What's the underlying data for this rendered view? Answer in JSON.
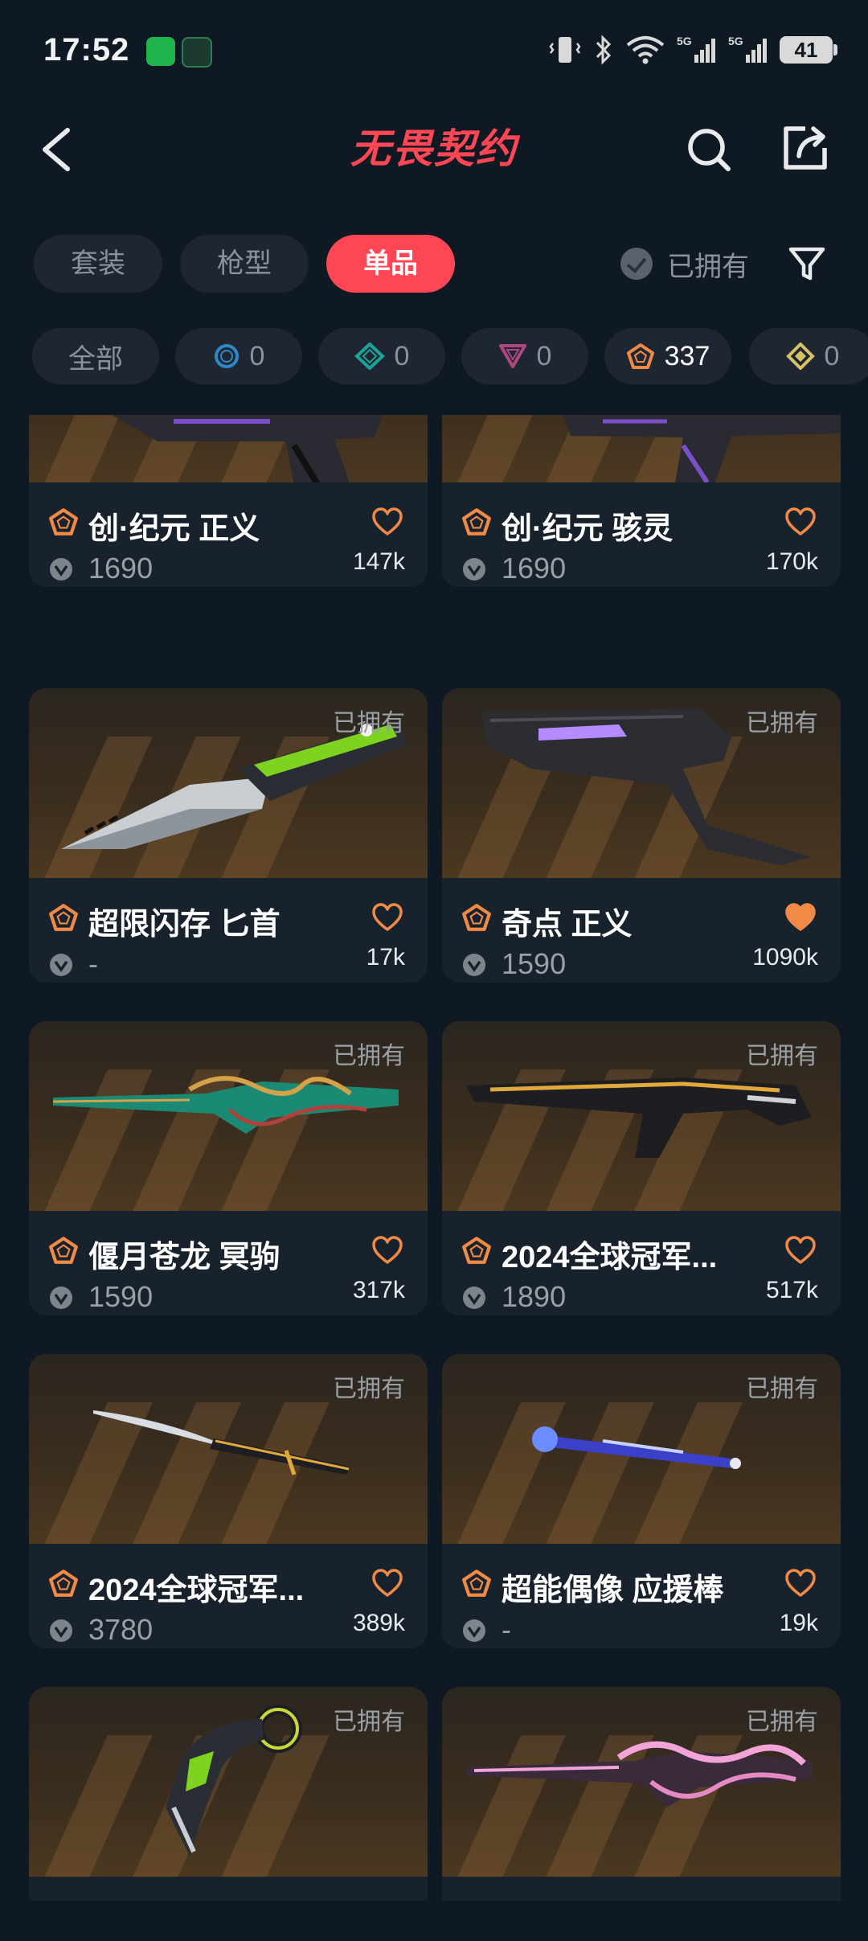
{
  "status_bar": {
    "time": "17:52",
    "battery": "41"
  },
  "header": {
    "logo_text": "无畏契约"
  },
  "tabs": [
    {
      "label": "套装",
      "active": false
    },
    {
      "label": "枪型",
      "active": false
    },
    {
      "label": "单品",
      "active": true
    }
  ],
  "owned_filter": {
    "label": "已拥有"
  },
  "rarity_chips": [
    {
      "label": "全部",
      "count": "",
      "icon": "none",
      "color": ""
    },
    {
      "label": "",
      "count": "0",
      "icon": "select-tier-icon",
      "color": "#2e88c8"
    },
    {
      "label": "",
      "count": "0",
      "icon": "deluxe-tier-icon",
      "color": "#1aa39a"
    },
    {
      "label": "",
      "count": "0",
      "icon": "premium-tier-icon",
      "color": "#b0457f"
    },
    {
      "label": "",
      "count": "337",
      "icon": "exclusive-tier-icon",
      "color": "#f08a46"
    },
    {
      "label": "",
      "count": "0",
      "icon": "ultra-tier-icon",
      "color": "#d8c266"
    }
  ],
  "accent_color": "#ff4655",
  "items": [
    {
      "name": "创·纪元 正义",
      "price": "1690",
      "likes": "147k",
      "owned_label": "",
      "favorited": false,
      "weapon": "pistol-dark"
    },
    {
      "name": "创·纪元 骇灵",
      "price": "1690",
      "likes": "170k",
      "owned_label": "",
      "favorited": false,
      "weapon": "smg-dark"
    },
    {
      "name": "超限闪存 匕首",
      "price": "-",
      "likes": "17k",
      "owned_label": "已拥有",
      "favorited": false,
      "weapon": "knife-green"
    },
    {
      "name": "奇点 正义",
      "price": "1590",
      "likes": "1090k",
      "owned_label": "已拥有",
      "favorited": true,
      "weapon": "revolver-purple"
    },
    {
      "name": "偃月苍龙 冥驹",
      "price": "1590",
      "likes": "317k",
      "owned_label": "已拥有",
      "favorited": false,
      "weapon": "sniper-dragon"
    },
    {
      "name": "2024全球冠军...",
      "price": "1890",
      "likes": "517k",
      "owned_label": "已拥有",
      "favorited": false,
      "weapon": "smg-gold"
    },
    {
      "name": "2024全球冠军...",
      "price": "3780",
      "likes": "389k",
      "owned_label": "已拥有",
      "favorited": false,
      "weapon": "katana-gold"
    },
    {
      "name": "超能偶像 应援棒",
      "price": "-",
      "likes": "19k",
      "owned_label": "已拥有",
      "favorited": false,
      "weapon": "lightstick-blue"
    },
    {
      "name": "",
      "price": "",
      "likes": "",
      "owned_label": "已拥有",
      "favorited": false,
      "weapon": "karambit-green"
    },
    {
      "name": "",
      "price": "",
      "likes": "",
      "owned_label": "已拥有",
      "favorited": false,
      "weapon": "sniper-pink"
    }
  ]
}
